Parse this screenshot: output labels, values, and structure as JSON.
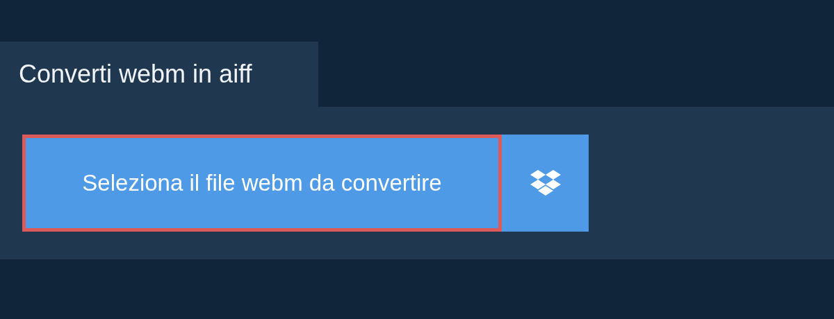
{
  "tab": {
    "label": "Converti webm in aiff"
  },
  "select_button": {
    "label": "Seleziona il file webm da convertire",
    "focused": true
  }
}
